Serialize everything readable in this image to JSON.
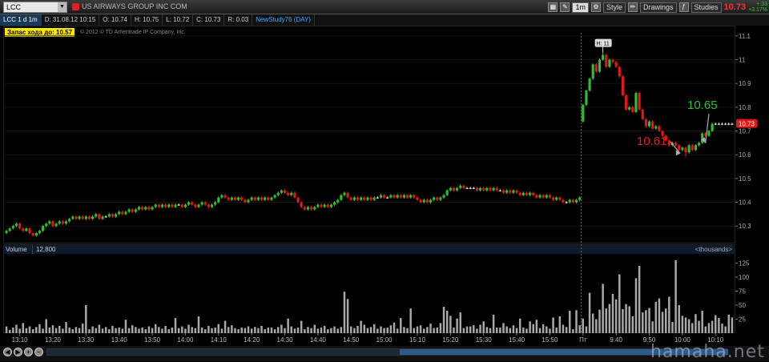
{
  "topbar": {
    "symbol": "LCC",
    "company": "US AIRWAYS GROUP INC COM",
    "timeframe": "1m",
    "style_label": "Style",
    "drawings_label": "Drawings",
    "studies_label": "Studies",
    "last_price": "10.73",
    "change_abs": "+.33",
    "change_pct": "+3.17%"
  },
  "infobar": {
    "symbol_period": "LCC 1 d 1m",
    "date": "D: 31.08.12 10:15",
    "open": "O: 10.74",
    "high": "H: 10.75",
    "low": "L: 10.72",
    "close": "C: 10.73",
    "range": "R: 0.03",
    "study": "NewStudy76 (DAY)"
  },
  "price_panel": {
    "reserve_label": "Запас хода до: 10.57",
    "copyright": "© 2012 © TD Ameritrade IP Company, Inc.",
    "high_marker": "H: 11",
    "annotation_low": "10.61",
    "annotation_high": "10.65",
    "current_price_tag": "10.73"
  },
  "volume_panel": {
    "label": "Volume",
    "value": "12,800",
    "units": "<thousands>"
  },
  "watermark": "hamaha.net",
  "colors": {
    "up": "#2fbf2f",
    "down": "#e01818",
    "doji": "#e8e8e8",
    "volume": "#a8a8a8",
    "annotation_low": "#e02020",
    "annotation_high": "#2fbf2f"
  },
  "chart_data": {
    "type": "candlestick",
    "price_axis": {
      "ticks": [
        10.3,
        10.4,
        10.5,
        10.6,
        10.7,
        10.8,
        10.9,
        11,
        11.1
      ],
      "range": [
        10.23,
        11.14
      ]
    },
    "volume_axis": {
      "ticks": [
        25,
        50,
        75,
        100,
        125
      ],
      "range": [
        0,
        140
      ]
    },
    "x_tick_labels": [
      {
        "label": "13:10",
        "bar": 4
      },
      {
        "label": "13:20",
        "bar": 14
      },
      {
        "label": "13:30",
        "bar": 24
      },
      {
        "label": "13:40",
        "bar": 34
      },
      {
        "label": "13:50",
        "bar": 44
      },
      {
        "label": "14:00",
        "bar": 54
      },
      {
        "label": "14:10",
        "bar": 64
      },
      {
        "label": "14:20",
        "bar": 74
      },
      {
        "label": "14:30",
        "bar": 84
      },
      {
        "label": "14:40",
        "bar": 94
      },
      {
        "label": "14:50",
        "bar": 104
      },
      {
        "label": "15:00",
        "bar": 114
      },
      {
        "label": "15:10",
        "bar": 124
      },
      {
        "label": "15:20",
        "bar": 134
      },
      {
        "label": "15:30",
        "bar": 144
      },
      {
        "label": "15:40",
        "bar": 154
      },
      {
        "label": "15:50",
        "bar": 164
      },
      {
        "label": "Пт",
        "bar": 174
      },
      {
        "label": "9:40",
        "bar": 184
      },
      {
        "label": "9:50",
        "bar": 194
      },
      {
        "label": "10:00",
        "bar": 204
      },
      {
        "label": "10:10",
        "bar": 214
      }
    ],
    "session_break_bar": 173.5,
    "bar_count": 220,
    "closes": [
      10.28,
      10.29,
      10.3,
      10.31,
      10.29,
      10.28,
      10.29,
      10.27,
      10.26,
      10.27,
      10.28,
      10.3,
      10.31,
      10.32,
      10.3,
      10.31,
      10.32,
      10.31,
      10.32,
      10.33,
      10.34,
      10.33,
      10.34,
      10.33,
      10.34,
      10.33,
      10.34,
      10.35,
      10.33,
      10.34,
      10.34,
      10.35,
      10.34,
      10.35,
      10.36,
      10.35,
      10.36,
      10.37,
      10.36,
      10.37,
      10.38,
      10.37,
      10.38,
      10.37,
      10.38,
      10.39,
      10.38,
      10.39,
      10.38,
      10.39,
      10.38,
      10.39,
      10.39,
      10.38,
      10.39,
      10.4,
      10.39,
      10.38,
      10.39,
      10.4,
      10.39,
      10.38,
      10.39,
      10.4,
      10.42,
      10.43,
      10.42,
      10.41,
      10.42,
      10.41,
      10.42,
      10.41,
      10.4,
      10.41,
      10.42,
      10.41,
      10.42,
      10.41,
      10.42,
      10.41,
      10.42,
      10.43,
      10.44,
      10.45,
      10.44,
      10.43,
      10.44,
      10.42,
      10.4,
      10.38,
      10.37,
      10.38,
      10.37,
      10.38,
      10.39,
      10.38,
      10.39,
      10.38,
      10.39,
      10.4,
      10.41,
      10.43,
      10.44,
      10.42,
      10.41,
      10.42,
      10.41,
      10.42,
      10.41,
      10.42,
      10.41,
      10.42,
      10.42,
      10.43,
      10.42,
      10.42,
      10.43,
      10.42,
      10.43,
      10.42,
      10.43,
      10.42,
      10.43,
      10.42,
      10.41,
      10.4,
      10.41,
      10.4,
      10.41,
      10.42,
      10.41,
      10.42,
      10.43,
      10.45,
      10.46,
      10.45,
      10.46,
      10.47,
      10.46,
      10.46,
      10.46,
      10.46,
      10.45,
      10.46,
      10.45,
      10.46,
      10.45,
      10.46,
      10.45,
      10.45,
      10.44,
      10.45,
      10.44,
      10.45,
      10.44,
      10.43,
      10.44,
      10.43,
      10.44,
      10.43,
      10.42,
      10.43,
      10.42,
      10.43,
      10.42,
      10.41,
      10.42,
      10.41,
      10.4,
      10.4,
      10.41,
      10.4,
      10.41,
      10.42,
      10.81,
      10.87,
      10.92,
      10.98,
      10.95,
      11.0,
      11.02,
      10.97,
      11.0,
      10.99,
      10.97,
      10.93,
      10.85,
      10.79,
      10.8,
      10.78,
      10.86,
      10.79,
      10.75,
      10.72,
      10.74,
      10.71,
      10.72,
      10.7,
      10.68,
      10.66,
      10.64,
      10.65,
      10.64,
      10.62,
      10.63,
      10.61,
      10.64,
      10.62,
      10.64,
      10.65,
      10.69,
      10.68,
      10.7,
      10.73,
      10.73,
      10.73,
      10.73,
      10.73,
      10.73,
      10.73
    ],
    "volumes": [
      12,
      6,
      10,
      15,
      8,
      18,
      9,
      12,
      7,
      11,
      16,
      8,
      25,
      10,
      14,
      9,
      13,
      8,
      20,
      10,
      7,
      11,
      9,
      17,
      50,
      7,
      12,
      9,
      15,
      8,
      11,
      7,
      13,
      9,
      10,
      8,
      24,
      9,
      14,
      11,
      8,
      10,
      7,
      12,
      9,
      16,
      11,
      8,
      13,
      7,
      10,
      27,
      9,
      12,
      8,
      15,
      11,
      9,
      30,
      10,
      7,
      13,
      9,
      10,
      16,
      8,
      22,
      11,
      14,
      9,
      7,
      10,
      9,
      12,
      8,
      11,
      9,
      13,
      7,
      10,
      10,
      7,
      11,
      15,
      9,
      26,
      12,
      8,
      10,
      22,
      7,
      11,
      9,
      15,
      8,
      10,
      13,
      7,
      9,
      12,
      8,
      11,
      74,
      61,
      12,
      9,
      13,
      22,
      15,
      9,
      11,
      16,
      8,
      12,
      9,
      10,
      14,
      19,
      8,
      27,
      11,
      9,
      44,
      9,
      12,
      14,
      8,
      11,
      17,
      9,
      10,
      18,
      47,
      40,
      31,
      10,
      26,
      37,
      9,
      12,
      12,
      14,
      8,
      15,
      21,
      11,
      9,
      33,
      10,
      10,
      18,
      12,
      9,
      14,
      9,
      26,
      10,
      8,
      21,
      16,
      24,
      9,
      16,
      12,
      8,
      28,
      10,
      30,
      15,
      11,
      40,
      7,
      41,
      14,
      26,
      12,
      72,
      35,
      25,
      42,
      88,
      44,
      52,
      70,
      60,
      105,
      43,
      52,
      48,
      30,
      98,
      120,
      37,
      41,
      45,
      21,
      56,
      62,
      38,
      44,
      65,
      20,
      130,
      50,
      31,
      28,
      25,
      18,
      34,
      22,
      40,
      12,
      18,
      22,
      32,
      27,
      17,
      12,
      33,
      28
    ]
  }
}
